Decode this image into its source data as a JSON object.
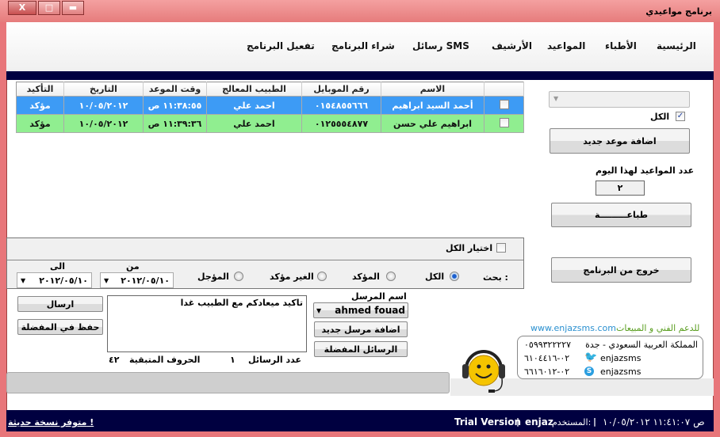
{
  "window": {
    "title": "برنامج مواعيدي",
    "close": "X",
    "maximize": "□",
    "minimize": "▬"
  },
  "nav": [
    "الرئيسية",
    "الأطباء",
    "المواعيد",
    "الأرشيف",
    "رسائل SMS",
    "شراء البرنامج",
    "تفعيل البرنامج"
  ],
  "grid": {
    "headers": [
      "",
      "الاسم",
      "رقم الموبايل",
      "الطبيب المعالج",
      "وقت الموعد",
      "التاريخ",
      "التأكيد"
    ],
    "rows": [
      {
        "name": "أحمد السيد ابراهيم",
        "mobile": "٠١٥٤٨٥٥٦٦٦",
        "doctor": "احمد علي",
        "time": "١١:٣٨:٥٥ ص",
        "date": "١٠/٠٥/٢٠١٢",
        "confirm": "مؤكد"
      },
      {
        "name": "ابراهيم علي حسن",
        "mobile": "٠١٢٥٥٥٤٨٧٧",
        "doctor": "احمد علي",
        "time": "١١:٣٩:٣٦ ص",
        "date": "١٠/٠٥/٢٠١٢",
        "confirm": "مؤكد"
      }
    ]
  },
  "side": {
    "all_label": "الكل",
    "add_button": "اضافة موعد جديد",
    "today_count_label": "عدد المواعيد لهذا اليوم",
    "today_count": "٢",
    "print_button": "طباعـــــــــة",
    "exit_button": "خروج من البرنامج"
  },
  "filter": {
    "select_all": "اختيار الكل",
    "search_label": "بحث :",
    "options": [
      "الكل",
      "المؤكد",
      "الغير مؤكد",
      "المؤجل"
    ],
    "selected": "الكل",
    "from_label": "من",
    "from_value": "٢٠١٢/٠٥/١٠",
    "to_label": "الى",
    "to_value": "٢٠١٢/٠٥/١٠"
  },
  "sms": {
    "send_button": "ارسال",
    "save_fav_button": "حفظ في المفضلة",
    "message": "تاكيد ميعادكم مع الطبيب غدا",
    "messages_count_label": "عدد الرسائل",
    "messages_count": "١",
    "remaining_label": "الحروف المتبقية",
    "remaining": "٤٢",
    "sender_label": "اسم المرسل",
    "sender_value": "ahmed fouad",
    "add_sender_button": "اضافة مرسل جديد",
    "fav_messages_button": "الرسائل المفضلة"
  },
  "support": {
    "label": "للدعم الفني و المبيعات",
    "website": "www.enjazsms.com",
    "address": "المملكة العربية السعودي - جدة",
    "phone1": "٠٥٩٩٣٢٢٢٢٧",
    "phone2": "٠٢-٦١٠٤٤١٦",
    "phone3": "٠٢-٦٦١٦٠١٢",
    "twitter": "enjazsms",
    "skype": "enjazsms"
  },
  "status": {
    "datetime": "ص ١١:٤١:٠٧ ١٠/٠٥/٢٠١٢",
    "user_label": "المستخدم:",
    "user": "enjaz",
    "version": "Trial Version",
    "update_link": "متوفر نسخة حديثة !"
  },
  "colors": {
    "accent_navy": "#000040",
    "row_blue": "#3d9bf5",
    "row_green": "#90ee90"
  }
}
